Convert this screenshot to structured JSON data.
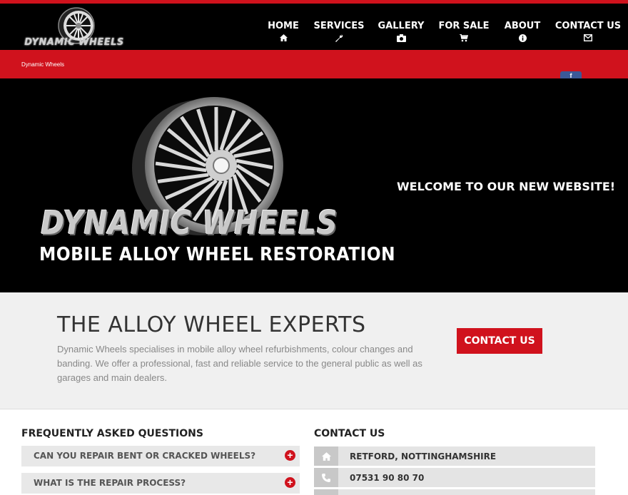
{
  "header": {
    "logo_text": "DYNAMIC WHEELS",
    "nav": [
      {
        "label": "HOME",
        "icon": "home-icon"
      },
      {
        "label": "SERVICES",
        "icon": "wrench-icon"
      },
      {
        "label": "GALLERY",
        "icon": "camera-icon"
      },
      {
        "label": "FOR SALE",
        "icon": "cart-icon"
      },
      {
        "label": "ABOUT",
        "icon": "info-icon"
      },
      {
        "label": "CONTACT US",
        "icon": "envelope-icon"
      }
    ]
  },
  "breadcrumb": "Dynamic Wheels",
  "social": {
    "facebook_label": "f"
  },
  "hero": {
    "brand_title": "DYNAMIC WHEELS",
    "brand_subtitle": "MOBILE ALLOY WHEEL RESTORATION",
    "welcome": "WELCOME TO OUR NEW WEBSITE!"
  },
  "intro": {
    "title": "THE ALLOY WHEEL EXPERTS",
    "text": "Dynamic Wheels specialises in mobile alloy wheel refurbishments, colour changes and banding. We offer a professional, fast and reliable service to the general public as well as garages and main dealers.",
    "cta_label": "CONTACT US"
  },
  "faq": {
    "title": "FREQUENTLY ASKED QUESTIONS",
    "items": [
      {
        "label": "CAN YOU REPAIR BENT OR CRACKED WHEELS?",
        "icon": "plus-circle-icon"
      },
      {
        "label": "WHAT IS THE REPAIR PROCESS?",
        "icon": "plus-circle-icon"
      }
    ]
  },
  "contact": {
    "title": "CONTACT US",
    "rows": [
      {
        "text": "RETFORD, NOTTINGHAMSHIRE",
        "icon": "home-icon"
      },
      {
        "text": "07531 90 80 70",
        "icon": "phone-icon"
      }
    ]
  },
  "colors": {
    "brand_red": "#d0121d",
    "header_black": "#000000",
    "panel_grey": "#f0f0f0",
    "facebook_blue": "#3b5998"
  }
}
